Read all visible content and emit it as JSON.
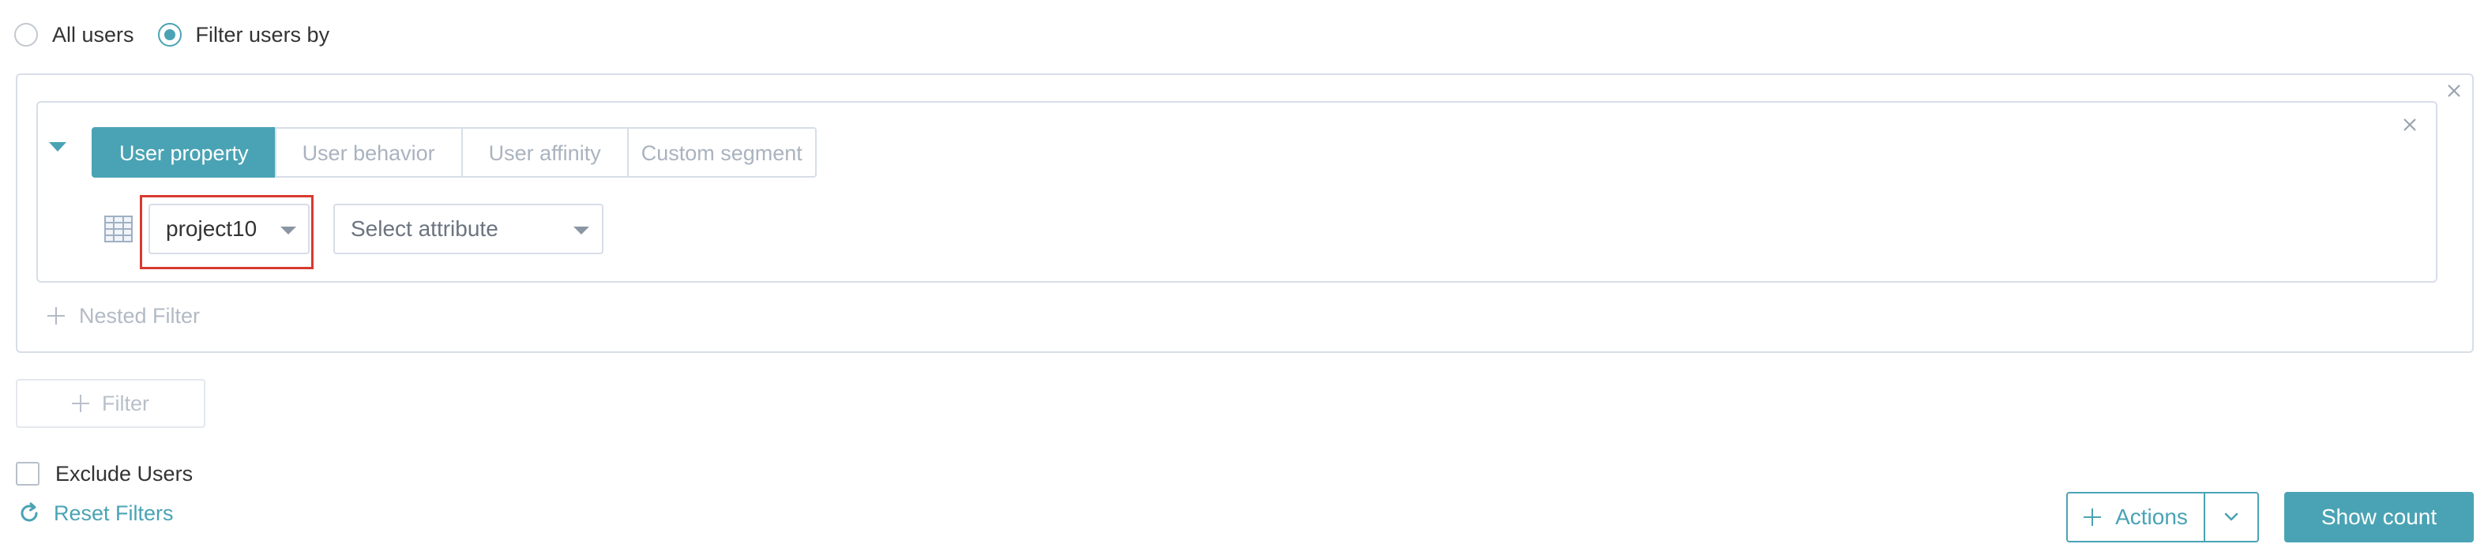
{
  "audience": {
    "options": [
      {
        "label": "All users",
        "checked": false
      },
      {
        "label": "Filter users by",
        "checked": true
      }
    ]
  },
  "filter_group": {
    "tabs": [
      {
        "label": "User property",
        "active": true
      },
      {
        "label": "User behavior",
        "active": false
      },
      {
        "label": "User affinity",
        "active": false
      },
      {
        "label": "Custom segment",
        "active": false
      }
    ],
    "project_select": {
      "value": "project10"
    },
    "attribute_select": {
      "placeholder": "Select attribute"
    },
    "nested_filter_label": "Nested Filter"
  },
  "filter_button_label": "Filter",
  "exclude_users": {
    "label": "Exclude Users",
    "checked": false
  },
  "reset_filters_label": "Reset Filters",
  "footer": {
    "actions_label": "Actions",
    "show_count_label": "Show count"
  },
  "icons": {
    "close": "close-icon",
    "collapse": "caret-down-icon",
    "table": "table-icon",
    "plus": "plus-icon",
    "reset": "refresh-icon",
    "dropdown": "chevron-down-icon"
  },
  "colors": {
    "accent": "#4aa3b4",
    "highlight": "#d73a2f",
    "border": "#d7dee8"
  }
}
